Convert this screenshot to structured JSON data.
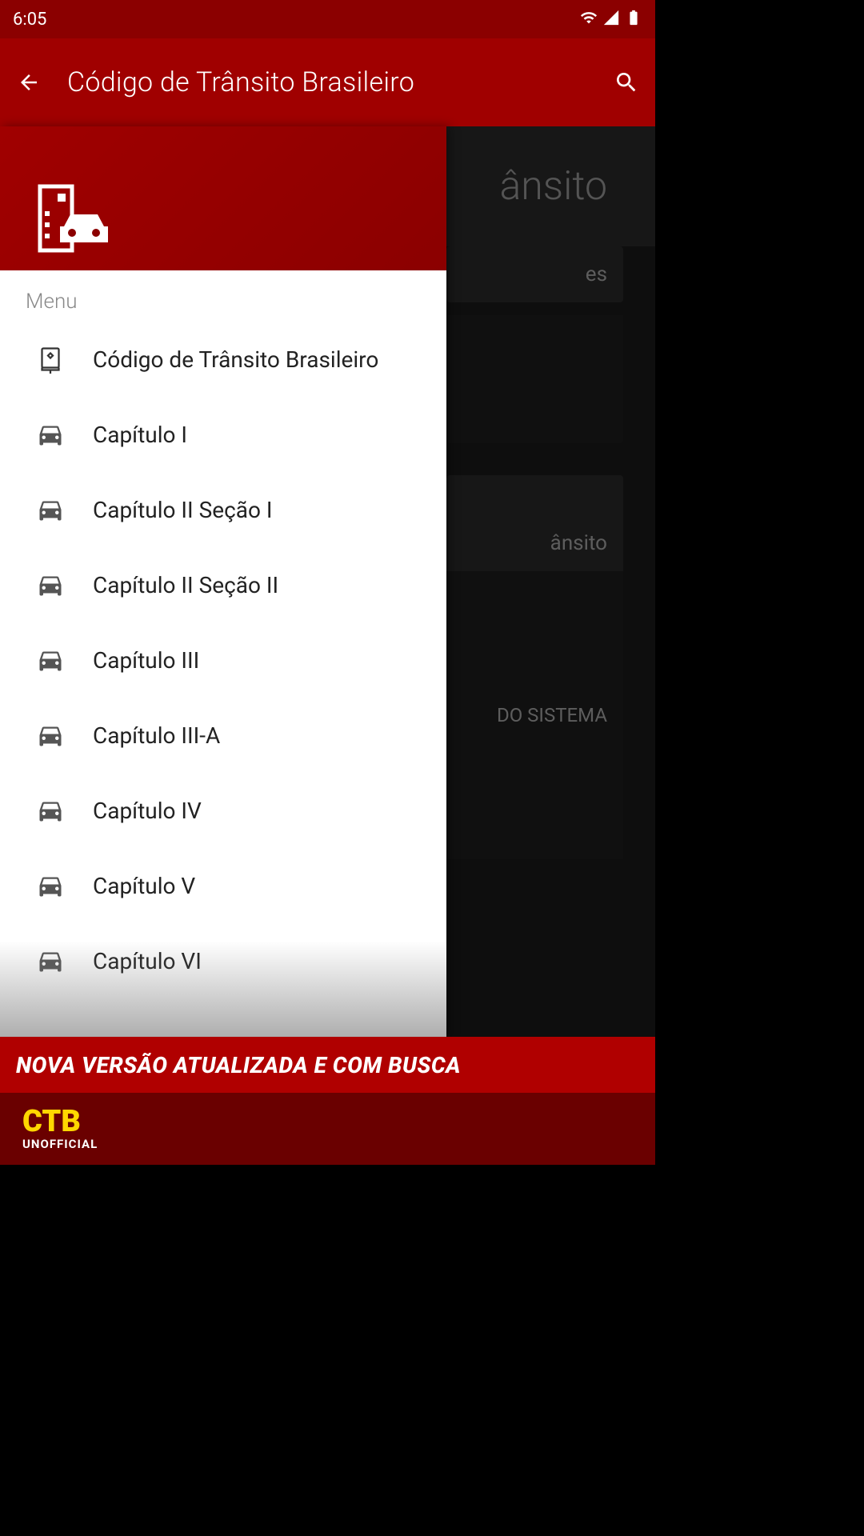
{
  "status": {
    "time": "6:05"
  },
  "appbar": {
    "title": "Código de Trânsito Brasileiro"
  },
  "bg": {
    "header_fragment": "ânsito",
    "card1_fragment": "es",
    "card3_fragment": "ânsito",
    "card4_fragment": "DO SISTEMA"
  },
  "drawer": {
    "menu_label": "Menu",
    "items": [
      {
        "icon": "book",
        "label": "Código de Trânsito Brasileiro"
      },
      {
        "icon": "car",
        "label": "Capítulo I"
      },
      {
        "icon": "car",
        "label": "Capítulo II Seção I"
      },
      {
        "icon": "car",
        "label": "Capítulo II Seção II"
      },
      {
        "icon": "car",
        "label": "Capítulo III"
      },
      {
        "icon": "car",
        "label": "Capítulo III-A"
      },
      {
        "icon": "car",
        "label": "Capítulo IV"
      },
      {
        "icon": "car",
        "label": "Capítulo V"
      },
      {
        "icon": "car",
        "label": "Capítulo VI"
      }
    ]
  },
  "banner": {
    "text": "NOVA VERSÃO ATUALIZADA E COM BUSCA"
  },
  "footer": {
    "logo": "CTB",
    "sub": "UNOFFICIAL"
  }
}
